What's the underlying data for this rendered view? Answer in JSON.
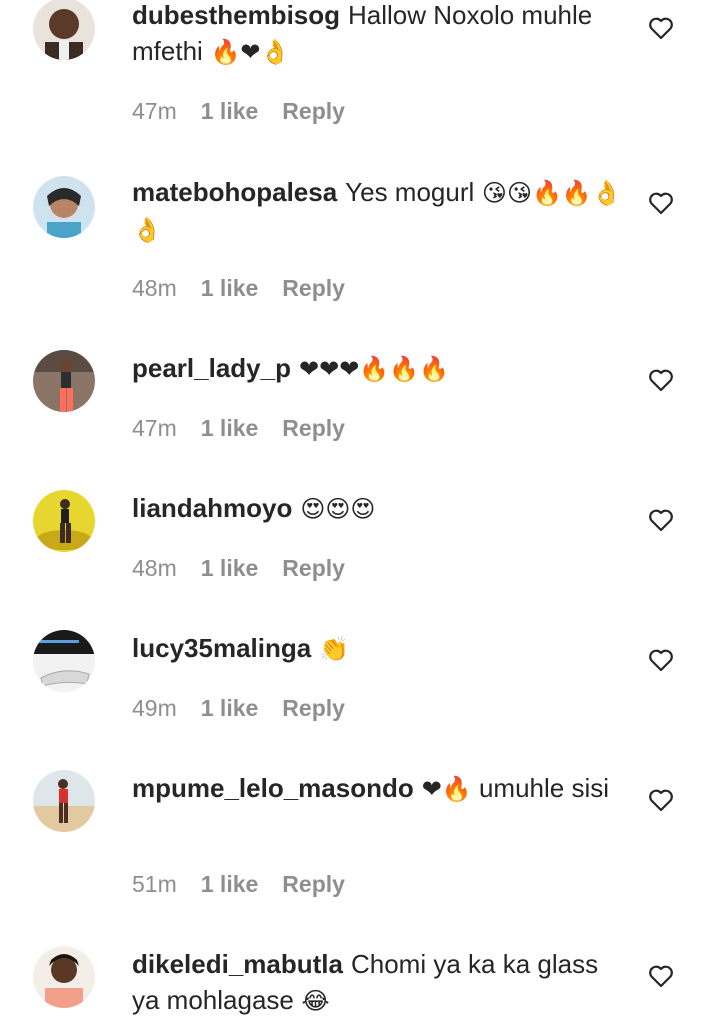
{
  "comments": [
    {
      "username": "dubesthembisog",
      "text": "Hallow Noxolo muhle mfethi",
      "emojis": "🔥❤👌",
      "time": "47m",
      "likes": "1 like",
      "reply": "Reply"
    },
    {
      "username": "matebohopalesa",
      "text": "Yes mogurl",
      "emojis": "😘😘🔥🔥👌👌",
      "time": "48m",
      "likes": "1 like",
      "reply": "Reply"
    },
    {
      "username": "pearl_lady_p",
      "text": "",
      "emojis": "❤❤❤🔥🔥🔥",
      "time": "47m",
      "likes": "1 like",
      "reply": "Reply"
    },
    {
      "username": "liandahmoyo",
      "text": "",
      "emojis": "😍😍😍",
      "time": "48m",
      "likes": "1 like",
      "reply": "Reply"
    },
    {
      "username": "lucy35malinga",
      "text": "",
      "emojis": "👏",
      "time": "49m",
      "likes": "1 like",
      "reply": "Reply"
    },
    {
      "username": "mpume_lelo_masondo",
      "text": "umuhle sisi",
      "emojis": "❤🔥",
      "time": "51m",
      "likes": "1 like",
      "reply": "Reply"
    },
    {
      "username": "dikeledi_mabutla",
      "text": "Chomi ya ka ka glass ya mohlagase",
      "emojis": "😂",
      "time": "",
      "likes": "",
      "reply": ""
    }
  ],
  "colors": {
    "text": "#262626",
    "meta": "#8e8e8e",
    "heart_outline": "#262626"
  },
  "icons": {
    "like": "heart-outline-icon"
  }
}
